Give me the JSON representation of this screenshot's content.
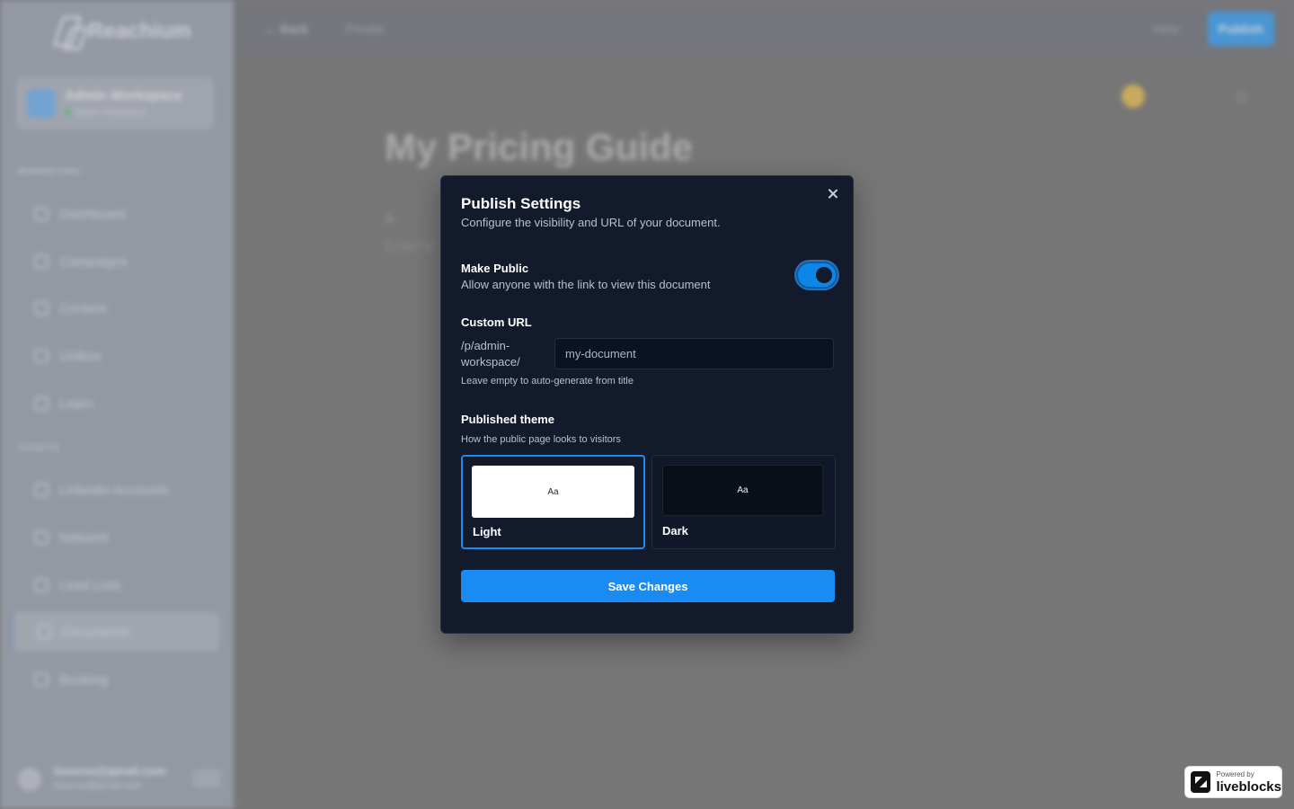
{
  "app": {
    "logo_text": "Reachium",
    "workspace": {
      "name": "Admin Workspace",
      "status": "Active Workspace"
    },
    "sections": [
      {
        "label": "MARKETING",
        "items": [
          {
            "label": "Dashboard",
            "icon": "home-icon"
          },
          {
            "label": "Campaigns",
            "icon": "campaign-icon"
          },
          {
            "label": "Content",
            "icon": "content-icon"
          },
          {
            "label": "Unibox",
            "icon": "inbox-icon"
          },
          {
            "label": "Learn",
            "icon": "learn-icon"
          }
        ]
      },
      {
        "label": "ASSETS",
        "items": [
          {
            "label": "LinkedIn Accounts",
            "icon": "user-icon"
          },
          {
            "label": "Network",
            "icon": "network-icon"
          },
          {
            "label": "Lead Lists",
            "icon": "list-icon"
          },
          {
            "label": "Documents",
            "icon": "document-icon",
            "active": true
          },
          {
            "label": "Booking",
            "icon": "calendar-icon"
          }
        ]
      }
    ],
    "user": {
      "email": "losuruo@gmail.com",
      "sub": "losuruo@gmail.com"
    },
    "topbar": {
      "back": "← Back",
      "private": "Private",
      "view": "View",
      "publish": "Publish"
    },
    "document": {
      "title": "My Pricing Guide",
      "line1": "A",
      "line2": "Enter te"
    }
  },
  "modal": {
    "title": "Publish Settings",
    "description": "Configure the visibility and URL of your document.",
    "make_public": {
      "label": "Make Public",
      "help": "Allow anyone with the link to view this document",
      "enabled": true
    },
    "custom_url": {
      "label": "Custom URL",
      "prefix": "/p/admin-workspace/",
      "placeholder": "my-document",
      "value": "",
      "help": "Leave empty to auto-generate from title"
    },
    "theme": {
      "label": "Published theme",
      "help": "How the public page looks to visitors",
      "selected": "Light",
      "options": [
        {
          "name": "Light",
          "preview": "Aa"
        },
        {
          "name": "Dark",
          "preview": "Aa"
        }
      ]
    },
    "save_label": "Save Changes"
  },
  "badge": {
    "powered_by": "Powered by",
    "brand": "liveblocks"
  },
  "colors": {
    "accent": "#1a8bf2",
    "modal_bg": "#121a2c",
    "input_bg": "#0b1222"
  }
}
